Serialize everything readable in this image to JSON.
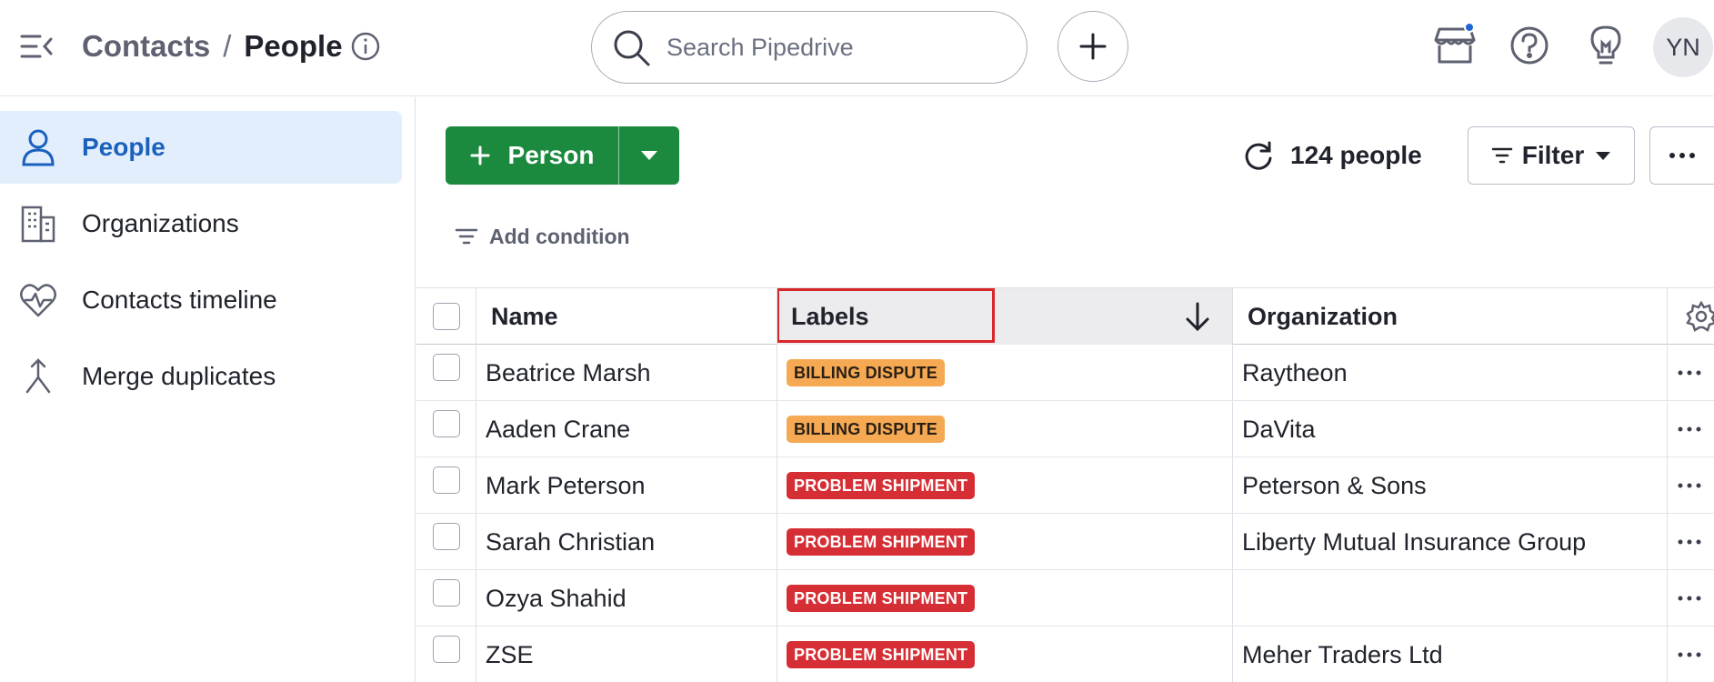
{
  "header": {
    "breadcrumb_parent": "Contacts",
    "breadcrumb_separator": "/",
    "breadcrumb_current": "People",
    "search_placeholder": "Search Pipedrive",
    "avatar_initials": "YN"
  },
  "sidebar": {
    "items": [
      {
        "label": "People",
        "icon": "person-icon",
        "active": true
      },
      {
        "label": "Organizations",
        "icon": "building-icon",
        "active": false
      },
      {
        "label": "Contacts timeline",
        "icon": "heart-pulse-icon",
        "active": false
      },
      {
        "label": "Merge duplicates",
        "icon": "merge-icon",
        "active": false
      }
    ]
  },
  "toolbar": {
    "add_person_label": "Person",
    "count_label": "124 people",
    "filter_label": "Filter",
    "add_condition_label": "Add condition"
  },
  "table": {
    "columns": [
      "Name",
      "Labels",
      "Organization"
    ],
    "sorted_column": "Labels",
    "sort_direction": "descending",
    "rows": [
      {
        "name": "Beatrice Marsh",
        "label": "BILLING DISPUTE",
        "label_type": "billing",
        "organization": "Raytheon"
      },
      {
        "name": "Aaden Crane",
        "label": "BILLING DISPUTE",
        "label_type": "billing",
        "organization": "DaVita"
      },
      {
        "name": "Mark Peterson",
        "label": "PROBLEM SHIPMENT",
        "label_type": "problem",
        "organization": "Peterson & Sons"
      },
      {
        "name": "Sarah Christian",
        "label": "PROBLEM SHIPMENT",
        "label_type": "problem",
        "organization": "Liberty Mutual Insurance Group"
      },
      {
        "name": "Ozya Shahid",
        "label": "PROBLEM SHIPMENT",
        "label_type": "problem",
        "organization": ""
      },
      {
        "name": "ZSE",
        "label": "PROBLEM SHIPMENT",
        "label_type": "problem",
        "organization": "Meher Traders Ltd"
      }
    ]
  },
  "colors": {
    "primary_green": "#1c8a3e",
    "active_blue": "#1a61be",
    "billing_badge_bg": "#f6a953",
    "billing_badge_text": "#2b2015",
    "problem_badge_bg": "#d62e35",
    "problem_badge_text": "#ffffff",
    "highlight_red": "#d9262b"
  }
}
